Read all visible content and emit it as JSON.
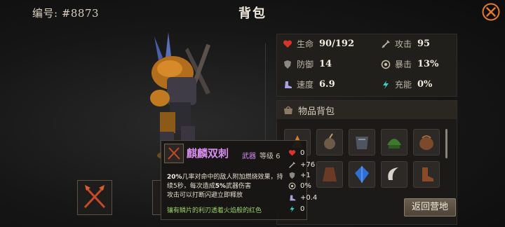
{
  "header": {
    "id_label": "编号: #8873",
    "title": "背包"
  },
  "stats": [
    {
      "icon": "heart-icon",
      "label": "生命",
      "value": "90/192"
    },
    {
      "icon": "sword-icon",
      "label": "攻击",
      "value": "95"
    },
    {
      "icon": "shield-icon",
      "label": "防御",
      "value": "14"
    },
    {
      "icon": "crit-icon",
      "label": "暴击",
      "value": "13%"
    },
    {
      "icon": "boot-icon",
      "label": "速度",
      "value": "6.9"
    },
    {
      "icon": "energy-icon",
      "label": "充能",
      "value": "0%"
    }
  ],
  "inventory": {
    "title": "物品背包"
  },
  "back_button": "返回营地",
  "tooltip": {
    "name": "麒麟双刺",
    "type": "武器",
    "level": "等级 6",
    "desc_pct1": "20%",
    "desc_a": "几率对命中的敌人附加燃烧效果，持续5秒，每次造成",
    "desc_pct2": "5%",
    "desc_b": "武器伤害",
    "desc_line3": "攻击可以打断闪避立即释放",
    "flavor": "镶有鳞片的利刃透着火焰般的红色",
    "stats": [
      {
        "icon": "heart-icon",
        "value": "0"
      },
      {
        "icon": "sword-icon",
        "value": "+76"
      },
      {
        "icon": "shield-icon",
        "value": "+1"
      },
      {
        "icon": "crit-icon",
        "value": "0%"
      },
      {
        "icon": "boot-icon",
        "value": "+0.4"
      },
      {
        "icon": "energy-icon",
        "value": "0"
      }
    ]
  },
  "colors": {
    "accent_orange": "#e07b2a",
    "epic_purple": "#d88cf0",
    "flavor_green": "#9cd36a"
  }
}
